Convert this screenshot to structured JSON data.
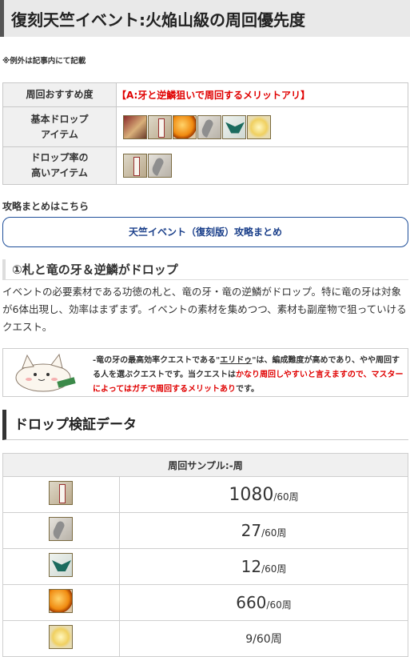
{
  "page": {
    "title": "復刻天竺イベント:火焔山級の周回優先度",
    "note": "※例外は記事内にて記載"
  },
  "info_table": {
    "rows": [
      {
        "head": "周回おすすめ度",
        "value": "【A:牙と逆鱗狙いで周回するメリットアリ】"
      },
      {
        "head": "基本ドロップ\nアイテム",
        "icons": [
          "monk-face-icon",
          "talisman-icon",
          "gem-orb-icon",
          "dragon-fang-icon",
          "dragon-scale-icon",
          "star-fragment-icon"
        ]
      },
      {
        "head": "ドロップ率の\n高いアイテム",
        "icons": [
          "talisman-icon",
          "dragon-fang-icon"
        ]
      }
    ]
  },
  "guide": {
    "label": "攻略まとめはこちら",
    "link": "天竺イベント（復刻版）攻略まとめ"
  },
  "section1": {
    "heading": "①札と竜の牙＆逆鱗がドロップ",
    "body": "イベントの必要素材である功徳の札と、竜の牙・竜の逆鱗がドロップ。特に竜の牙は対象が6体出現し、効率はまずまず。イベントの素材を集めつつ、素材も副産物で狙っていけるクエスト。"
  },
  "balloon": {
    "t1": "-竜の牙の最高効率クエストである\"",
    "link": "エリドゥ",
    "t2": "\"は、編成難度が高めであり、やや周回する人を選ぶクエストです。当クエストは",
    "red1": "かなり周回しやすいと言えますので、マスターによってはガチで周回するメリットあり",
    "t3": "です。"
  },
  "section2": {
    "heading": "ドロップ検証データ"
  },
  "drops": {
    "header": "周回サンプル:-周",
    "rows": [
      {
        "icon": "talisman-icon",
        "value": "1080",
        "unit": "/60周"
      },
      {
        "icon": "dragon-fang-icon",
        "value": "27",
        "unit": "/60周"
      },
      {
        "icon": "dragon-scale-icon",
        "value": "12",
        "unit": "/60周"
      },
      {
        "icon": "gem-orb-icon",
        "value": "660",
        "unit": "/60周"
      },
      {
        "icon": "star-fragment-icon",
        "value": "9/60周",
        "unit": ""
      }
    ]
  },
  "colors": {
    "accent_red": "#e00000",
    "link_blue": "#1a3f8a"
  }
}
